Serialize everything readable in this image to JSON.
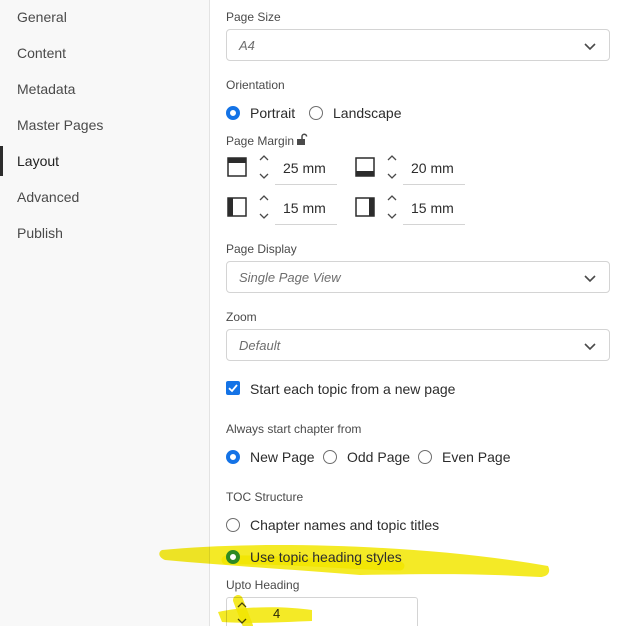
{
  "sidebar": {
    "items": [
      {
        "label": "General",
        "active": false
      },
      {
        "label": "Content",
        "active": false
      },
      {
        "label": "Metadata",
        "active": false
      },
      {
        "label": "Master Pages",
        "active": false
      },
      {
        "label": "Layout",
        "active": true
      },
      {
        "label": "Advanced",
        "active": false
      },
      {
        "label": "Publish",
        "active": false
      }
    ]
  },
  "page_size": {
    "label": "Page Size",
    "value": "A4"
  },
  "orientation": {
    "label": "Orientation",
    "options": [
      {
        "label": "Portrait",
        "checked": true
      },
      {
        "label": "Landscape",
        "checked": false
      }
    ]
  },
  "page_margin": {
    "label": "Page Margin",
    "top": "25 mm",
    "bottom": "20 mm",
    "left": "15 mm",
    "right": "15 mm"
  },
  "page_display": {
    "label": "Page Display",
    "value": "Single Page View"
  },
  "zoom": {
    "label": "Zoom",
    "value": "Default"
  },
  "start_each_topic": {
    "label": "Start each topic from a new page",
    "checked": true
  },
  "chapter_start": {
    "label": "Always start chapter from",
    "options": [
      {
        "label": "New Page",
        "checked": true
      },
      {
        "label": "Odd Page",
        "checked": false
      },
      {
        "label": "Even Page",
        "checked": false
      }
    ]
  },
  "toc_structure": {
    "label": "TOC Structure",
    "options": [
      {
        "label": "Chapter names and topic titles",
        "checked": false
      },
      {
        "label": "Use topic heading styles",
        "checked": true
      }
    ]
  },
  "upto_heading": {
    "label": "Upto Heading",
    "value": "4"
  },
  "colors": {
    "accent": "#1473e6",
    "highlight": "#f2e600",
    "selected_green": "#2d8a24"
  }
}
